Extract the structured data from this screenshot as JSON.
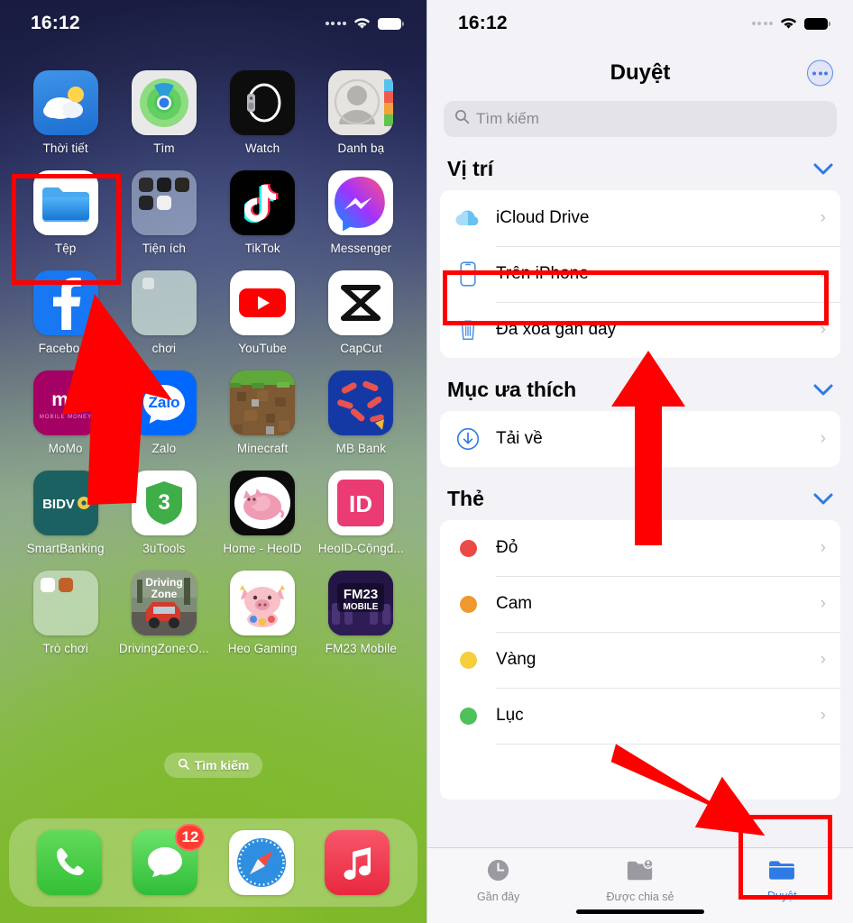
{
  "left_phone": {
    "status_bar": {
      "time": "16:12",
      "signal_icon": "signal-dots-icon",
      "wifi_icon": "wifi-icon",
      "battery_icon": "battery-full-icon"
    },
    "home_rows": [
      [
        {
          "label": "Thời tiết",
          "icon": "weather-app-icon"
        },
        {
          "label": "Tìm",
          "icon": "find-my-app-icon"
        },
        {
          "label": "Watch",
          "icon": "watch-app-icon"
        },
        {
          "label": "Danh bạ",
          "icon": "contacts-app-icon"
        }
      ],
      [
        {
          "label": "Tệp",
          "icon": "files-app-icon"
        },
        {
          "label": "Tiện ích",
          "icon": "utilities-folder-icon"
        },
        {
          "label": "TikTok",
          "icon": "tiktok-app-icon"
        },
        {
          "label": "Messenger",
          "icon": "messenger-app-icon"
        }
      ],
      [
        {
          "label": "Facebook",
          "icon": "facebook-app-icon"
        },
        {
          "label": "chơi",
          "icon": "games-folder-icon"
        },
        {
          "label": "YouTube",
          "icon": "youtube-app-icon"
        },
        {
          "label": "CapCut",
          "icon": "capcut-app-icon"
        }
      ],
      [
        {
          "label": "MoMo",
          "icon": "momo-app-icon"
        },
        {
          "label": "Zalo",
          "icon": "zalo-app-icon"
        },
        {
          "label": "Minecraft",
          "icon": "minecraft-app-icon"
        },
        {
          "label": "MB Bank",
          "icon": "mbbank-app-icon"
        }
      ],
      [
        {
          "label": "SmartBanking",
          "icon": "bidv-app-icon"
        },
        {
          "label": "3uTools",
          "icon": "3utools-app-icon"
        },
        {
          "label": "Home - HeoID",
          "icon": "home-heoid-app-icon"
        },
        {
          "label": "HeoID-Cộngđ...",
          "icon": "heoid-congdong-app-icon"
        }
      ],
      [
        {
          "label": "Trò chơi",
          "icon": "tro-choi-folder-icon"
        },
        {
          "label": "DrivingZone:O...",
          "icon": "drivingzone-app-icon"
        },
        {
          "label": "Heo Gaming",
          "icon": "heo-gaming-app-icon"
        },
        {
          "label": "FM23 Mobile",
          "icon": "fm23-mobile-app-icon"
        }
      ]
    ],
    "search_pill": {
      "label": "Tìm kiếm",
      "icon": "search-icon"
    },
    "dock": [
      {
        "label": "Phone",
        "icon": "phone-app-icon",
        "badge": null
      },
      {
        "label": "Messages",
        "icon": "messages-app-icon",
        "badge": "12"
      },
      {
        "label": "Safari",
        "icon": "safari-app-icon",
        "badge": null
      },
      {
        "label": "Music",
        "icon": "music-app-icon",
        "badge": null
      }
    ]
  },
  "right_phone": {
    "status_bar": {
      "time": "16:12",
      "signal_icon": "signal-dots-icon",
      "wifi_icon": "wifi-icon",
      "battery_icon": "battery-full-icon"
    },
    "nav": {
      "title": "Duyệt",
      "more_icon": "more-ellipsis-icon"
    },
    "search": {
      "placeholder": "Tìm kiếm",
      "icon": "search-icon"
    },
    "sections": [
      {
        "title": "Vị trí",
        "collapse_icon": "chevron-down-icon",
        "rows": [
          {
            "label": "iCloud Drive",
            "icon": "icloud-icon",
            "chevron": "›"
          },
          {
            "label": "Trên iPhone",
            "icon": "iphone-icon",
            "chevron": "›"
          },
          {
            "label": "Đã xóa gần đây",
            "icon": "trash-icon",
            "chevron": "›"
          }
        ]
      },
      {
        "title": "Mục ưa thích",
        "collapse_icon": "chevron-down-icon",
        "rows": [
          {
            "label": "Tải về",
            "icon": "download-icon",
            "chevron": "›"
          }
        ]
      },
      {
        "title": "Thẻ",
        "collapse_icon": "chevron-down-icon",
        "rows": [
          {
            "label": "Đỏ",
            "icon": "tag-dot-icon",
            "color": "#ec4a46",
            "chevron": "›"
          },
          {
            "label": "Cam",
            "icon": "tag-dot-icon",
            "color": "#f0992e",
            "chevron": "›"
          },
          {
            "label": "Vàng",
            "icon": "tag-dot-icon",
            "color": "#f5cf3c",
            "chevron": "›"
          },
          {
            "label": "Lục",
            "icon": "tag-dot-icon",
            "color": "#4fc05a",
            "chevron": "›"
          }
        ]
      }
    ],
    "tabbar": [
      {
        "label": "Gần đây",
        "icon": "clock-icon",
        "active": false
      },
      {
        "label": "Được chia sẻ",
        "icon": "shared-folder-icon",
        "active": false
      },
      {
        "label": "Duyệt",
        "icon": "folder-icon",
        "active": true
      }
    ]
  },
  "annotations": {
    "accent_color": "#fe0000",
    "highlights": [
      {
        "name": "tep-app-highlight"
      },
      {
        "name": "tren-iphone-row-highlight"
      },
      {
        "name": "duyet-tab-highlight"
      }
    ],
    "arrows": [
      {
        "name": "arrow-to-tep-app"
      },
      {
        "name": "arrow-to-tren-iphone"
      },
      {
        "name": "arrow-to-duyet-tab"
      }
    ]
  }
}
